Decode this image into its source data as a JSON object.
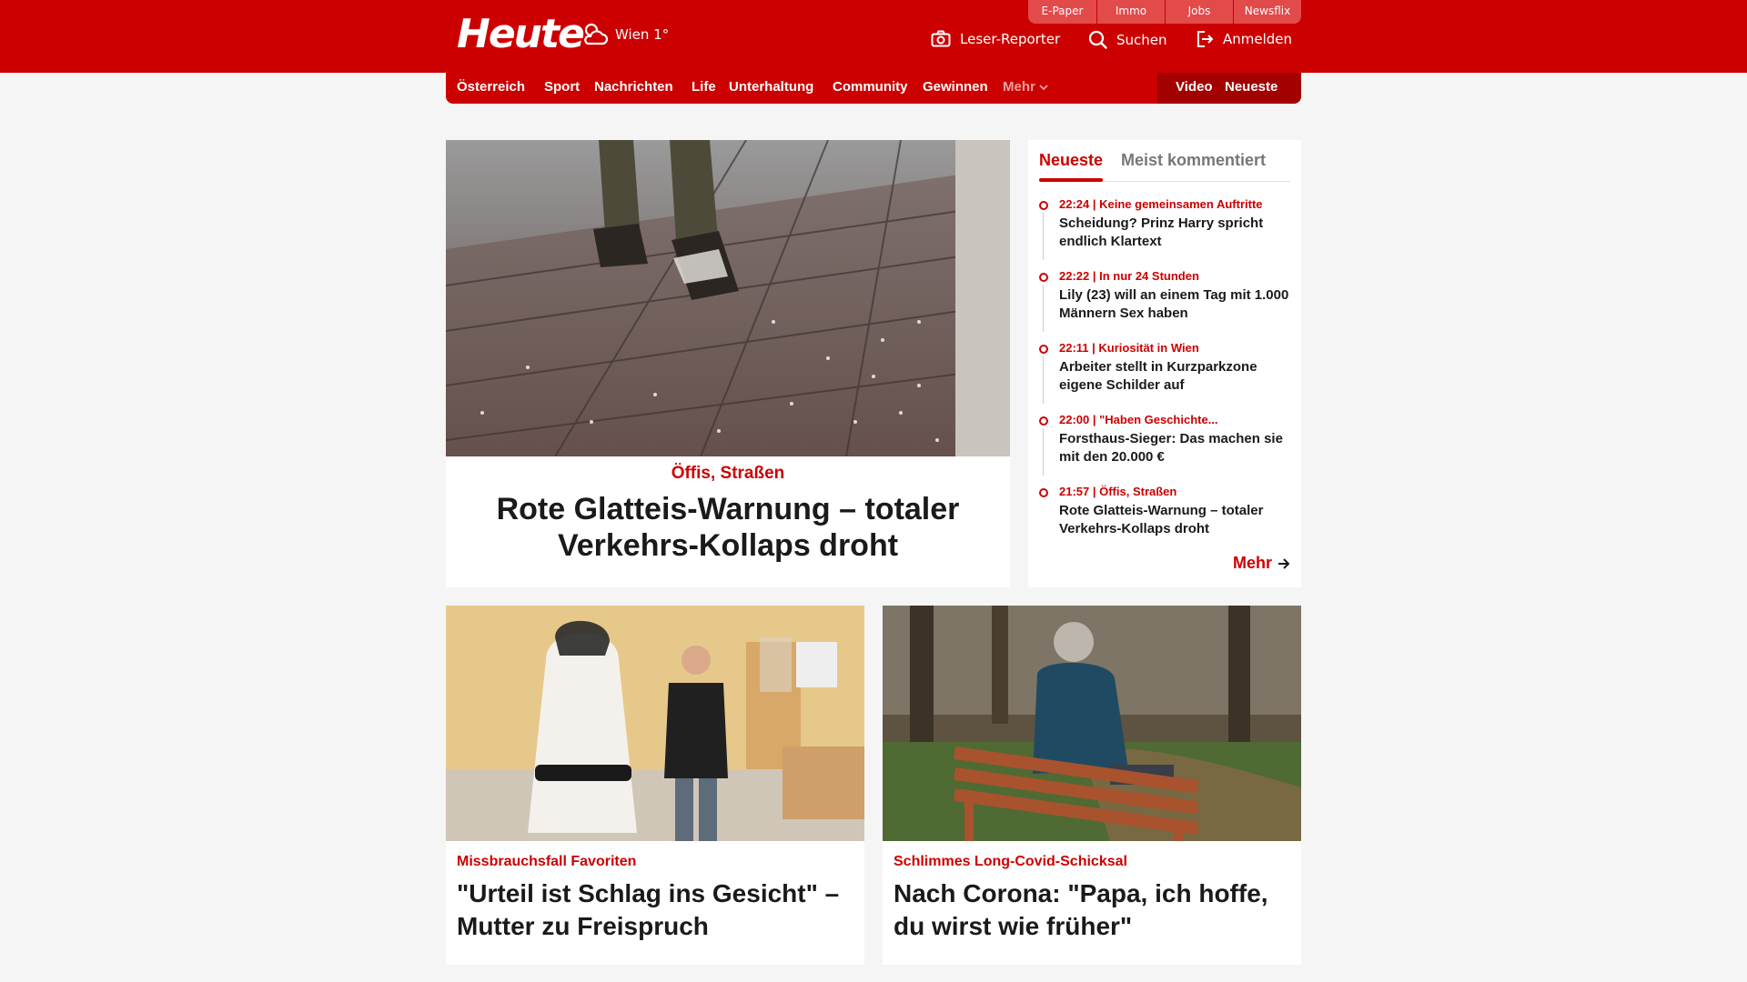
{
  "header": {
    "logo": "Heute",
    "weather": "Wien 1°",
    "services": [
      "E-Paper",
      "Immo",
      "Jobs",
      "Newsflix"
    ],
    "reporter_label": "Leser-Reporter",
    "search_label": "Suchen",
    "login_label": "Anmelden"
  },
  "nav": {
    "items": [
      "Österreich",
      "Sport",
      "Nachrichten",
      "Life",
      "Unterhaltung",
      "Community",
      "Gewinnen"
    ],
    "more": "Mehr",
    "video": "Video",
    "latest": "Neueste"
  },
  "hero": {
    "kicker": "Öffis, Straßen",
    "title": "Rote Glatteis-Warnung – totaler Verkehrs-Kollaps droht"
  },
  "sidebar": {
    "tab_active": "Neueste",
    "tab_inactive": "Meist kommentiert",
    "items": [
      {
        "meta": "22:24 | Keine gemeinsamen Auftritte",
        "title": "Scheidung? Prinz Harry spricht endlich Klartext"
      },
      {
        "meta": "22:22 | In nur 24 Stunden",
        "title": "Lily (23) will an einem Tag mit 1.000 Männern Sex haben"
      },
      {
        "meta": "22:11 | Kuriosität in Wien",
        "title": "Arbeiter stellt in Kurzparkzone eigene Schilder auf"
      },
      {
        "meta": "22:00 | \"Haben Geschichte...",
        "title": "Forsthaus-Sieger: Das machen sie mit den 20.000 €"
      },
      {
        "meta": "21:57 | Öffis, Straßen",
        "title": "Rote Glatteis-Warnung – totaler Verkehrs-Kollaps droht"
      }
    ],
    "more": "Mehr"
  },
  "cards": [
    {
      "kicker": "Missbrauchsfall Favoriten",
      "title": "\"Urteil ist Schlag ins Gesicht\" – Mutter zu Freispruch"
    },
    {
      "kicker": "Schlimmes Long-Covid-Schicksal",
      "title": "Nach Corona: \"Papa, ich hoffe, du wirst wie früher\""
    }
  ],
  "colors": {
    "brand": "#cc0000",
    "brand_dark": "#a30000",
    "background": "#f5f5f5"
  }
}
